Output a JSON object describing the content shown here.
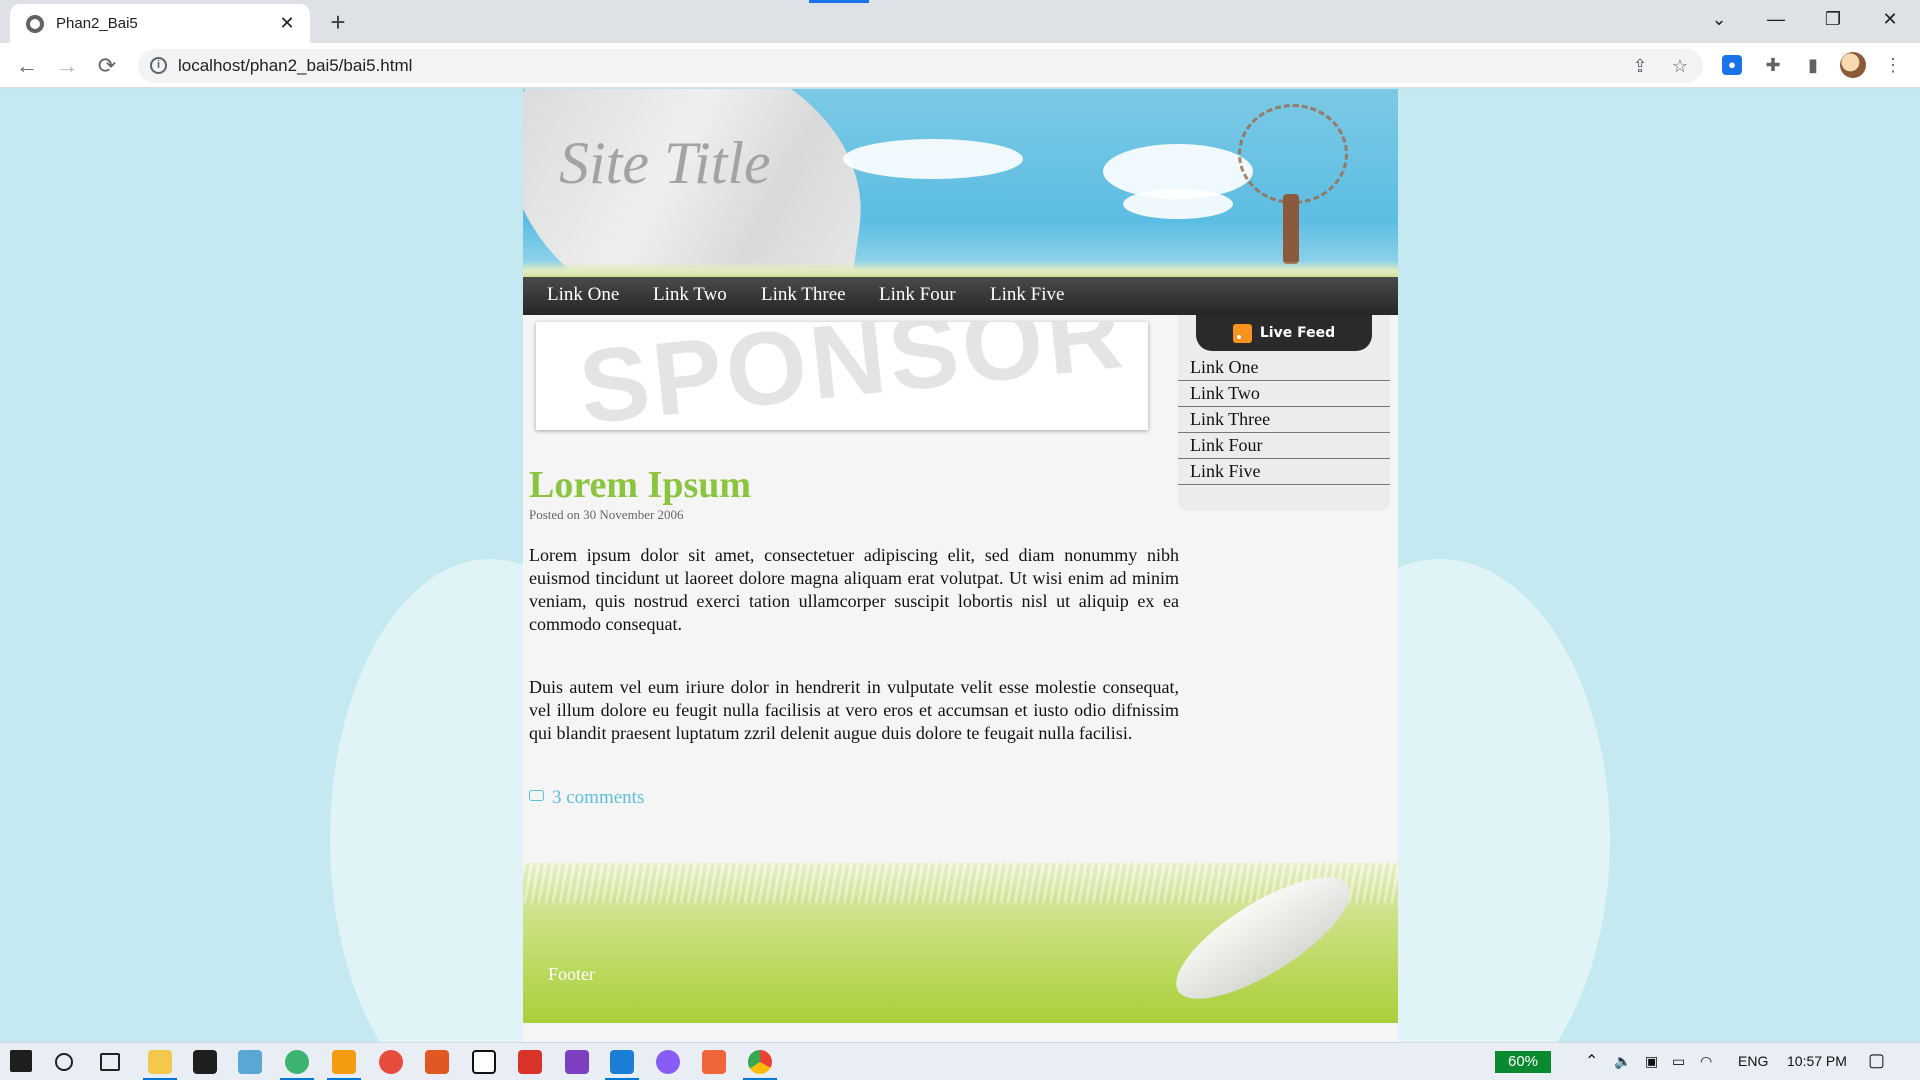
{
  "browser": {
    "tab_title": "Phan2_Bai5",
    "tab_close": "✕",
    "new_tab": "+",
    "url": "localhost/phan2_bai5/bai5.html",
    "window_controls": [
      "⌄",
      "—",
      "❐",
      "✕"
    ]
  },
  "site": {
    "title": "Site Title",
    "nav": [
      "Link One",
      "Link Two",
      "Link Three",
      "Link Four",
      "Link Five"
    ],
    "sponsor_text": "SPONSOR",
    "post": {
      "title": "Lorem Ipsum",
      "meta": "Posted on 30 November 2006",
      "paragraphs": [
        "Lorem ipsum dolor sit amet, consectetuer adipiscing elit, sed diam nonummy nibh euismod tincidunt ut laoreet dolore magna aliquam erat volutpat. Ut wisi enim ad minim veniam, quis nostrud exerci tation ullamcorper suscipit lobortis nisl ut aliquip ex ea commodo consequat.",
        "Duis autem vel eum iriure dolor in hendrerit in vulputate velit esse molestie consequat, vel illum dolore eu feugit nulla facilisis at vero eros et accumsan et iusto odio difnissim qui blandit praesent luptatum zzril delenit augue duis dolore te feugait nulla facilisi."
      ],
      "comments": "3 comments"
    },
    "sidebar": {
      "feed_label": "Live Feed",
      "links": [
        "Link One",
        "Link Two",
        "Link Three",
        "Link Four",
        "Link Five"
      ]
    },
    "footer": "Footer"
  },
  "taskbar": {
    "battery": "60%",
    "language": "ENG",
    "time": "10:57 PM"
  }
}
